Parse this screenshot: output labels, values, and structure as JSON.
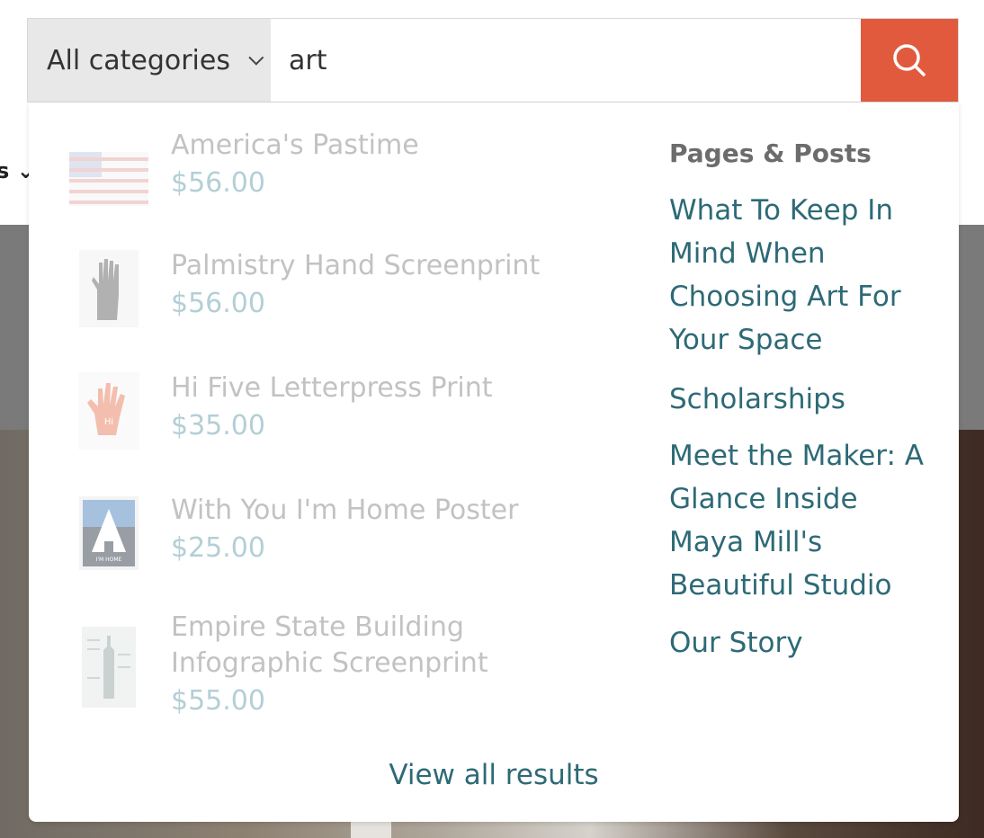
{
  "background": {
    "nav_fragment": "s ⌄"
  },
  "search": {
    "category_label": "All categories",
    "query": "art",
    "button_color": "#e15a3e"
  },
  "products": [
    {
      "name": "America's Pastime",
      "price": "$56.00"
    },
    {
      "name": "Palmistry Hand Screenprint",
      "price": "$56.00"
    },
    {
      "name": "Hi Five Letterpress Print",
      "price": "$35.00",
      "thumb_text": "Hi"
    },
    {
      "name": "With You I'm Home Poster",
      "price": "$25.00",
      "thumb_text": "I'M HOME"
    },
    {
      "name_line1": "Empire State Building",
      "name_line2": "Infographic Screenprint",
      "price": "$55.00"
    }
  ],
  "pages_posts": {
    "heading": "Pages & Posts",
    "links": [
      {
        "line1": "What To Keep In",
        "line2": "Mind When",
        "line3": "Choosing Art For",
        "line4": "Your Space"
      },
      {
        "line1": "Scholarships"
      },
      {
        "line1": "Meet the Maker: A",
        "line2": "Glance Inside",
        "line3": "Maya Mill's",
        "line4": "Beautiful Studio"
      },
      {
        "line1": "Our Story"
      }
    ]
  },
  "view_all_label": "View all results",
  "colors": {
    "link": "#2d6a76",
    "price": "#b3cfd6",
    "product_name": "#c2c2c2"
  }
}
